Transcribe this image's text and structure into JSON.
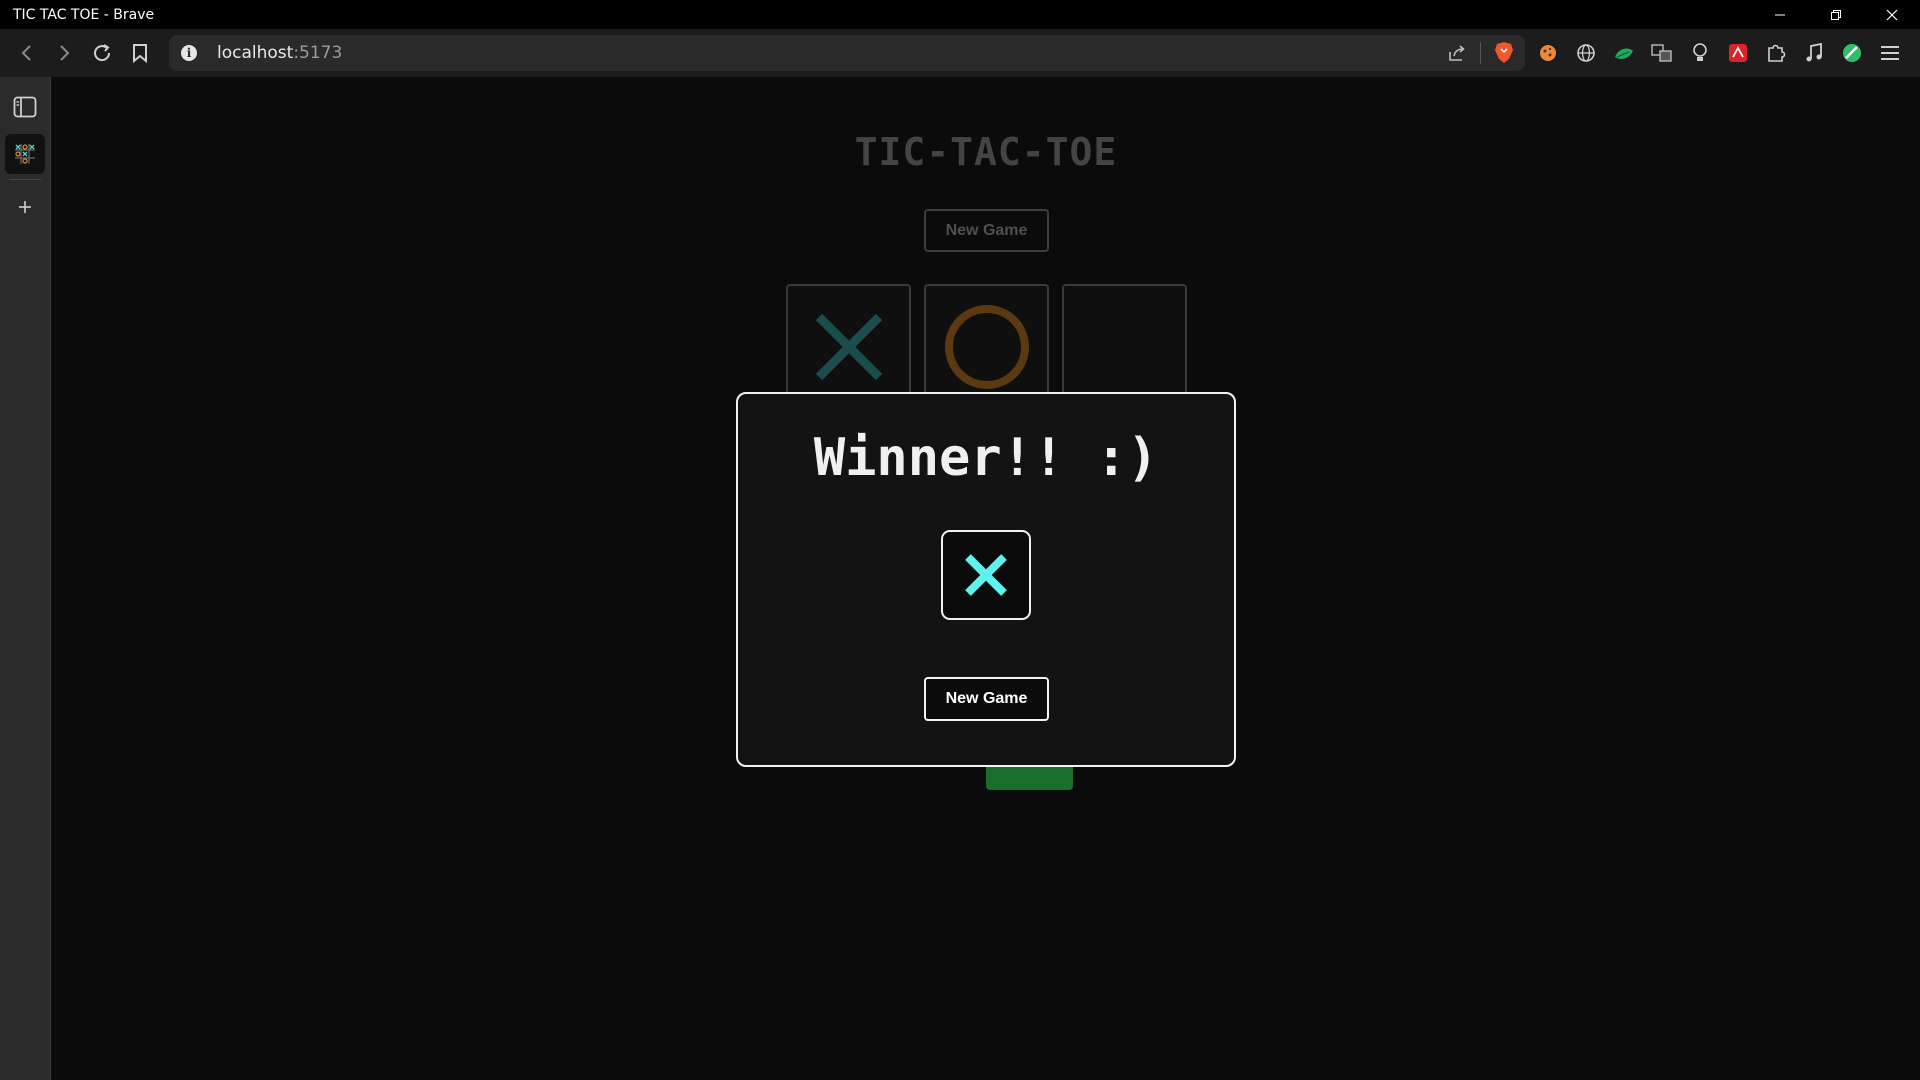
{
  "window": {
    "title": "TIC TAC TOE - Brave",
    "controls": [
      "minimize-icon",
      "restore-icon",
      "close-icon"
    ]
  },
  "toolbar": {
    "url_host": "localhost",
    "url_port": ":5173",
    "icons": [
      "back-icon",
      "forward-icon",
      "reload-icon",
      "bookmark-icon",
      "site-info-icon",
      "share-icon",
      "brave-shields-icon"
    ]
  },
  "extensions": [
    "cookie-extension-icon",
    "globe-extension-icon",
    "leaf-extension-icon",
    "translate-extension-icon",
    "bulb-extension-icon",
    "red-extension-icon",
    "puzzle-extensions-icon",
    "music-icon",
    "green-circle-icon",
    "menu-icon"
  ],
  "sidebar": {
    "items": [
      "sidebar-toggle-icon",
      "tictactoe-tab-icon",
      "add-icon"
    ]
  },
  "game": {
    "title": "TIC-TAC-TOE",
    "new_game_label": "New Game",
    "board": [
      {
        "mark": "X"
      },
      {
        "mark": "O"
      },
      {
        "mark": ""
      }
    ]
  },
  "modal": {
    "title": "Winner!! :)",
    "winner_mark": "X",
    "new_game_label": "New Game"
  },
  "colors": {
    "x_dim": "#1b4d4d",
    "o_dim": "#5b3a12",
    "x_bright": "#5ef2ef",
    "board_green": "#1a6e2a",
    "brave_orange": "#f0572a"
  }
}
